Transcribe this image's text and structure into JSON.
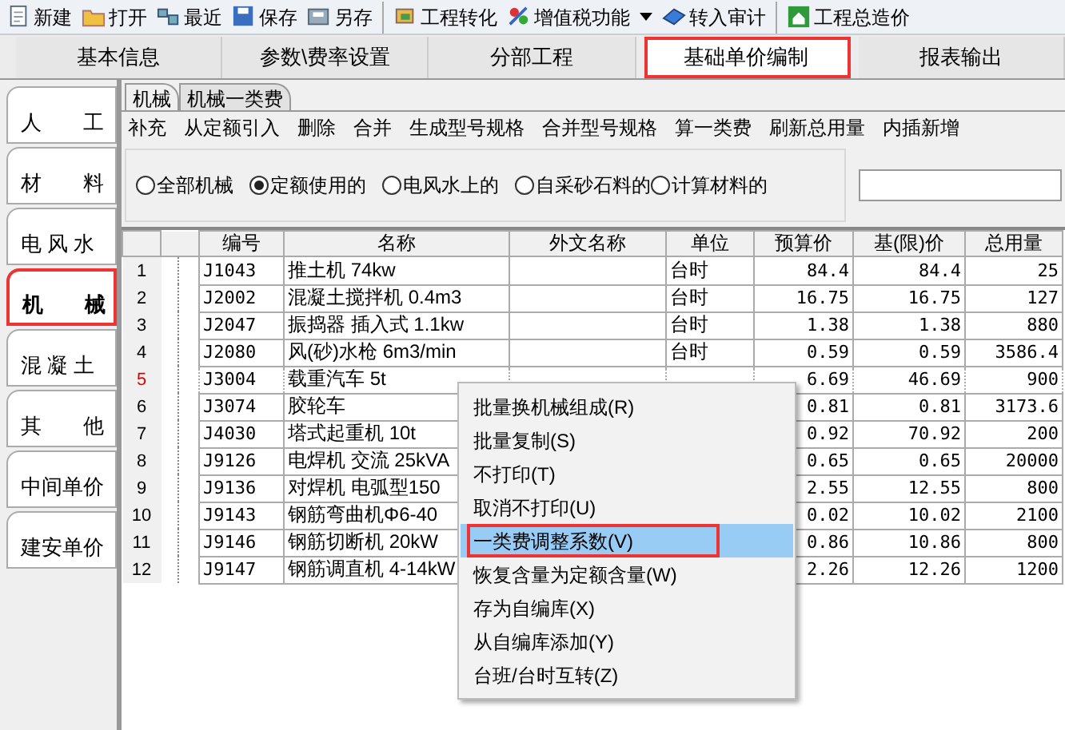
{
  "toolbar": [
    "新建",
    "打开",
    "最近",
    "保存",
    "另存",
    "工程转化",
    "增值税功能",
    "转入审计",
    "工程总造价"
  ],
  "main_tabs": [
    {
      "label": "基本信息",
      "selected": false
    },
    {
      "label": "参数\\费率设置",
      "selected": false
    },
    {
      "label": "分部工程",
      "selected": false
    },
    {
      "label": "基础单价编制",
      "selected": true
    },
    {
      "label": "报表输出",
      "selected": false
    }
  ],
  "side_tabs": [
    {
      "label": "人　　工",
      "selected": false
    },
    {
      "label": "材　　料",
      "selected": false
    },
    {
      "label": "电 风 水",
      "selected": false
    },
    {
      "label": "机　　械",
      "selected": true
    },
    {
      "label": "混 凝 土",
      "selected": false
    },
    {
      "label": "其　　他",
      "selected": false
    },
    {
      "label": "中间单价",
      "selected": false
    },
    {
      "label": "建安单价",
      "selected": false
    }
  ],
  "sub_tabs": [
    {
      "label": "机械",
      "selected": true
    },
    {
      "label": "机械一类费",
      "selected": false
    }
  ],
  "actions": [
    "补充",
    "从定额引入",
    "删除",
    "合并",
    "生成型号规格",
    "合并型号规格",
    "算一类费",
    "刷新总用量",
    "内插新增"
  ],
  "filters": [
    {
      "label": "全部机械",
      "selected": false
    },
    {
      "label": "定额使用的",
      "selected": true
    },
    {
      "label": "电风水上的",
      "selected": false
    },
    {
      "label": "自采砂石料的",
      "selected": false
    },
    {
      "label": "计算材料的",
      "selected": false
    }
  ],
  "table": {
    "columns": [
      "编号",
      "名称",
      "外文名称",
      "单位",
      "预算价",
      "基(限)价",
      "总用量"
    ],
    "rows": [
      {
        "index": "1",
        "code": "J1043",
        "name": "推土机 74kw",
        "unit": "台时",
        "budget": "84.4",
        "base": "84.4",
        "total": "25",
        "selected": false
      },
      {
        "index": "2",
        "code": "J2002",
        "name": "混凝土搅拌机 0.4m3",
        "unit": "台时",
        "budget": "16.75",
        "base": "16.75",
        "total": "127",
        "selected": false
      },
      {
        "index": "3",
        "code": "J2047",
        "name": "振捣器 插入式 1.1kw",
        "unit": "台时",
        "budget": "1.38",
        "base": "1.38",
        "total": "880",
        "selected": false
      },
      {
        "index": "4",
        "code": "J2080",
        "name": "风(砂)水枪 6m3/min",
        "unit": "台时",
        "budget": "0.59",
        "base": "0.59",
        "total": "3586.4",
        "selected": false
      },
      {
        "index": "5",
        "code": "J3004",
        "name": "载重汽车 5t",
        "budget": "6.69",
        "base": "46.69",
        "total": "900",
        "selected": true
      },
      {
        "index": "6",
        "code": "J3074",
        "name": "胶轮车",
        "budget": "0.81",
        "base": "0.81",
        "total": "3173.6",
        "selected": false
      },
      {
        "index": "7",
        "code": "J4030",
        "name": "塔式起重机 10t",
        "budget": "0.92",
        "base": "70.92",
        "total": "200",
        "selected": false
      },
      {
        "index": "8",
        "code": "J9126",
        "name": "电焊机 交流 25kVA",
        "budget": "0.65",
        "base": "0.65",
        "total": "20000",
        "selected": false
      },
      {
        "index": "9",
        "code": "J9136",
        "name": "对焊机 电弧型150",
        "budget": "2.55",
        "base": "12.55",
        "total": "800",
        "selected": false
      },
      {
        "index": "10",
        "code": "J9143",
        "name": "钢筋弯曲机Φ6-40",
        "budget": "0.02",
        "base": "10.02",
        "total": "2100",
        "selected": false
      },
      {
        "index": "11",
        "code": "J9146",
        "name": "钢筋切断机 20kW",
        "budget": "0.86",
        "base": "10.86",
        "total": "800",
        "selected": false
      },
      {
        "index": "12",
        "code": "J9147",
        "name": "钢筋调直机 4-14kW",
        "budget": "2.26",
        "base": "12.26",
        "total": "1200",
        "selected": false
      }
    ]
  },
  "context_menu": [
    {
      "label": "批量换机械组成(R)",
      "selected": false
    },
    {
      "label": "批量复制(S)",
      "selected": false
    },
    {
      "label": "不打印(T)",
      "selected": false
    },
    {
      "label": "取消不打印(U)",
      "selected": false
    },
    {
      "label": "一类费调整系数(V)",
      "selected": true
    },
    {
      "label": "恢复含量为定额含量(W)",
      "selected": false
    },
    {
      "label": "存为自编库(X)",
      "selected": false
    },
    {
      "label": "从自编库添加(Y)",
      "selected": false
    },
    {
      "label": "台班/台时互转(Z)",
      "selected": false
    }
  ]
}
